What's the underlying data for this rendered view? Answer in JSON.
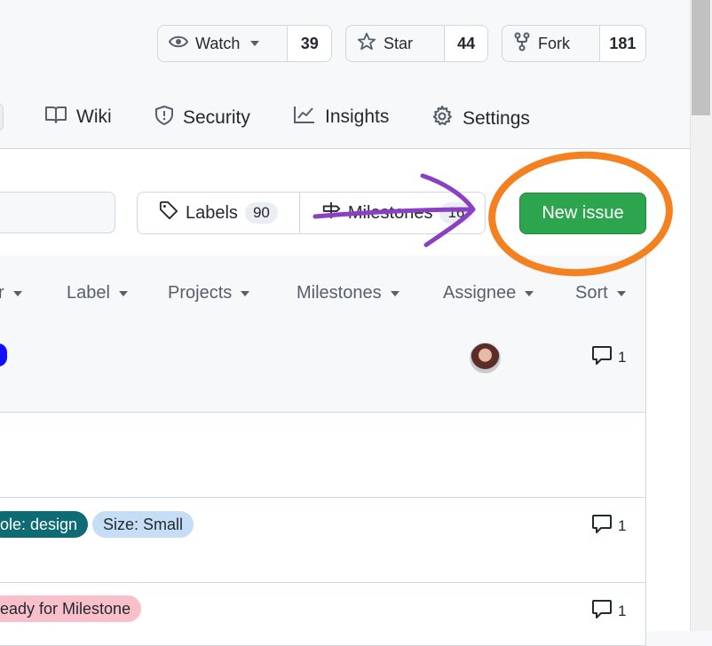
{
  "repo_actions": {
    "watch": {
      "label": "Watch",
      "count": "39"
    },
    "star": {
      "label": "Star",
      "count": "44"
    },
    "fork": {
      "label": "Fork",
      "count": "181"
    }
  },
  "tabs": [
    {
      "label": "Wiki",
      "icon": "book-icon"
    },
    {
      "label": "Security",
      "icon": "shield-icon"
    },
    {
      "label": "Insights",
      "icon": "graph-icon"
    },
    {
      "label": "Settings",
      "icon": "gear-icon"
    }
  ],
  "toolbar": {
    "labels": {
      "label": "Labels",
      "count": "90"
    },
    "milestones": {
      "label": "Milestones",
      "count": "16"
    },
    "new_issue": "New issue"
  },
  "filters": {
    "author_partial": "r",
    "label": "Label",
    "projects": "Projects",
    "milestones": "Milestones",
    "assignee": "Assignee",
    "sort": "Sort"
  },
  "rows": [
    {
      "comments": "1"
    },
    {
      "comments": ""
    },
    {
      "labels": [
        "ole: design",
        "Size: Small"
      ],
      "comments": "1"
    },
    {
      "labels": [
        "eady for Milestone"
      ],
      "comments": "1"
    }
  ],
  "colors": {
    "primary": "#2da44e",
    "annotation_circle": "#f5801f",
    "annotation_arrow": "#8a3fc4",
    "label_design": "#0e6b73",
    "label_size": "#c5def5",
    "label_milestone": "#f9c0cb"
  }
}
